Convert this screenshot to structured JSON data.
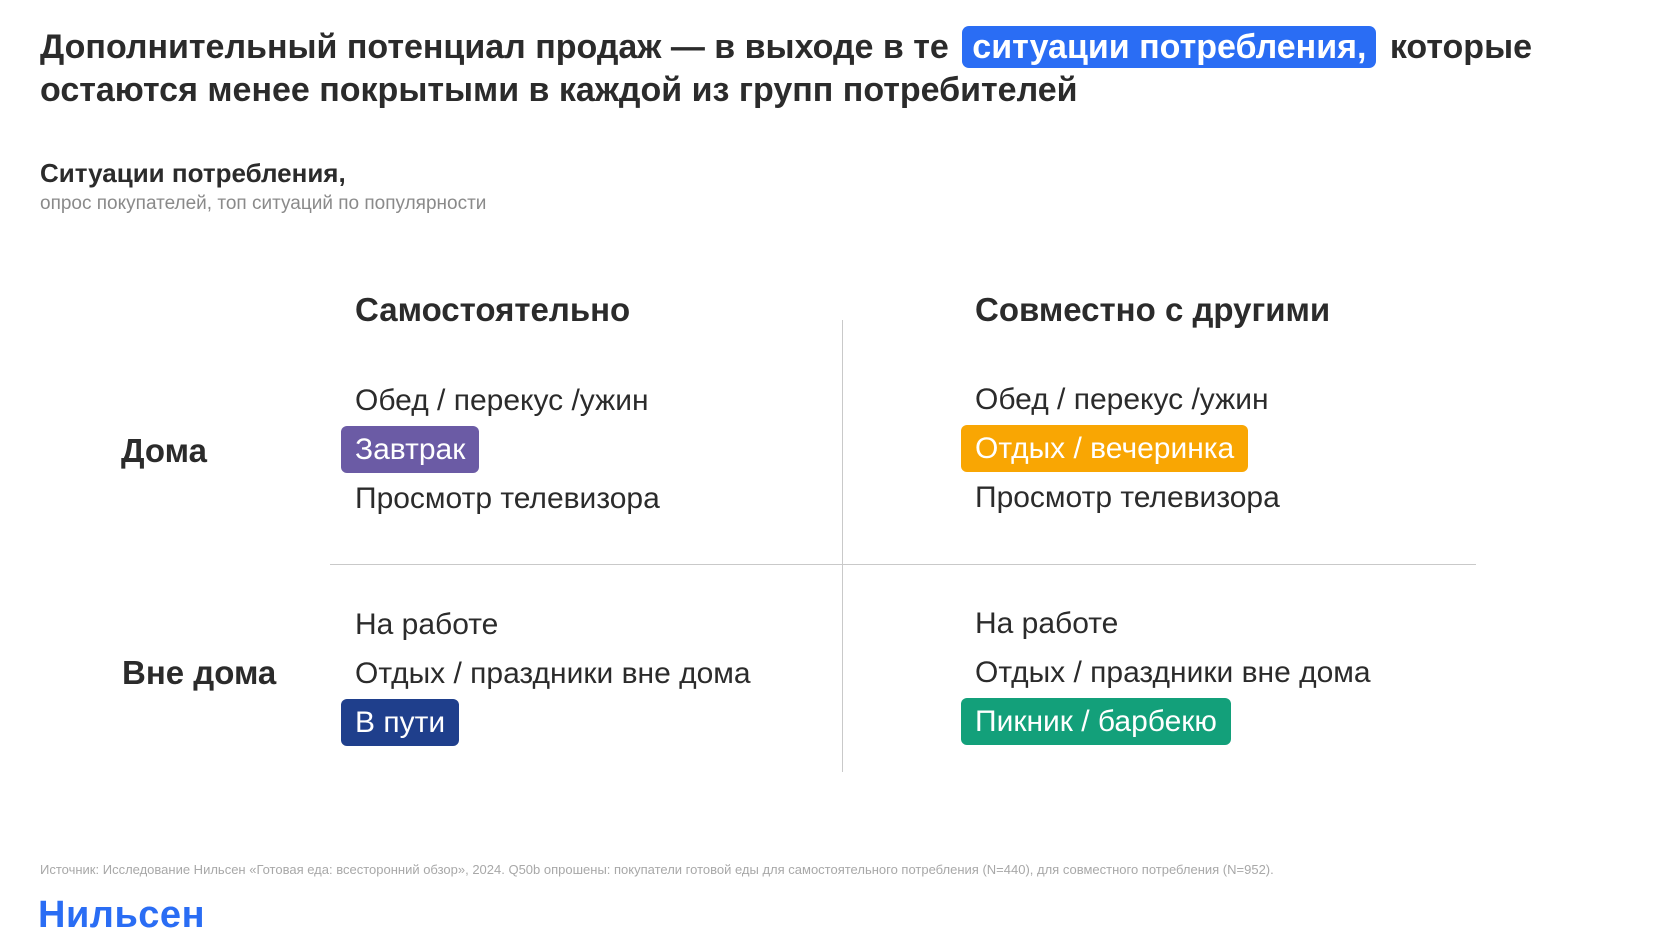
{
  "header": {
    "title_part1": "Дополнительный потенциал продаж — в выходе в те",
    "title_highlight": "ситуации потребления,",
    "title_part2": "которые остаются менее покрытыми в каждой из групп потребителей",
    "highlight_color": "#2a6df4"
  },
  "subtitle": {
    "title": "Ситуации потребления,",
    "caption": "опрос покупателей, топ ситуаций по популярности"
  },
  "matrix": {
    "columns": [
      "Самостоятельно",
      "Совместно с другими"
    ],
    "rows": [
      "Дома",
      "Вне дома"
    ],
    "cells": {
      "home_alone": [
        {
          "label": "Обед / перекус /ужин",
          "color": null
        },
        {
          "label": "Завтрак",
          "color": "#6b5ba5"
        },
        {
          "label": "Просмотр телевизора",
          "color": null
        }
      ],
      "home_together": [
        {
          "label": "Обед / перекус /ужин",
          "color": null
        },
        {
          "label": "Отдых / вечеринка",
          "color": "#f9a603"
        },
        {
          "label": "Просмотр телевизора",
          "color": null
        }
      ],
      "out_alone": [
        {
          "label": "На работе",
          "color": null
        },
        {
          "label": "Отдых / праздники вне дома",
          "color": null
        },
        {
          "label": "В пути",
          "color": "#1f3f8c"
        }
      ],
      "out_together": [
        {
          "label": "На работе",
          "color": null
        },
        {
          "label": "Отдых / праздники вне дома",
          "color": null
        },
        {
          "label": "Пикник / барбекю",
          "color": "#13a07a"
        }
      ]
    }
  },
  "footer": {
    "source": "Источник: Исследование Нильсен «Готовая еда: всесторонний обзор», 2024. Q50b опрошены: покупатели готовой еды для самостоятельного потребления (N=440), для совместного потребления (N=952).",
    "logo": "Нильсен"
  }
}
